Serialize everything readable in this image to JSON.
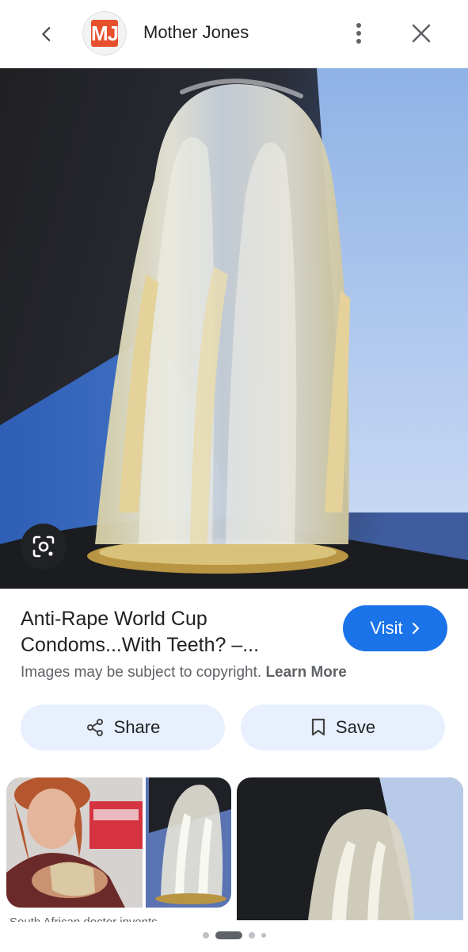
{
  "header": {
    "back_icon": "chevron-left-icon",
    "site_logo_text": "MJ",
    "site_name": "Mother Jones",
    "more_icon": "more-vert-icon",
    "close_icon": "close-icon"
  },
  "image": {
    "lens_icon": "google-lens-icon"
  },
  "result": {
    "title": "Anti-Rape World Cup Condoms...With Teeth? –...",
    "visit_label": "Visit",
    "copyright_text": "Images may be subject to copyright.",
    "learn_more_label": "Learn More"
  },
  "actions": {
    "share_label": "Share",
    "save_label": "Save"
  },
  "related": {
    "caption": "South African doctor invents..."
  },
  "pagination": {
    "total": 4,
    "active_index": 1
  },
  "colors": {
    "accent": "#1a73e8",
    "action_bg": "#e8f0fe",
    "logo_bg": "#e8502d"
  }
}
